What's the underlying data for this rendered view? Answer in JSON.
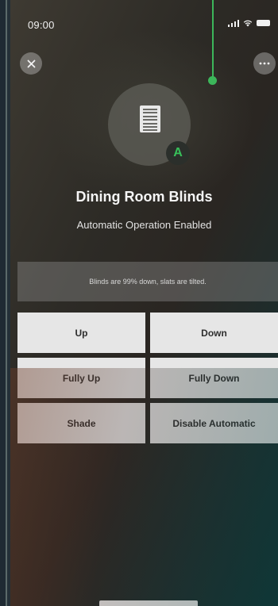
{
  "status_bar": {
    "time": "09:00"
  },
  "header": {
    "close_icon": "close-icon",
    "more_icon": "more-icon"
  },
  "device": {
    "icon": "window-blind-icon",
    "badge": "A",
    "name": "Dining Room Blinds",
    "subtitle": "Automatic Operation Enabled"
  },
  "status_message": "Blinds are 99% down, slats are tilted.",
  "actions": {
    "up": "Up",
    "down": "Down",
    "fully_up": "Fully Up",
    "fully_down": "Fully Down",
    "shade": "Shade",
    "disable_automatic": "Disable Automatic"
  },
  "colors": {
    "accent_green": "#3cb65a",
    "button_bg": "#e6e6e6"
  }
}
